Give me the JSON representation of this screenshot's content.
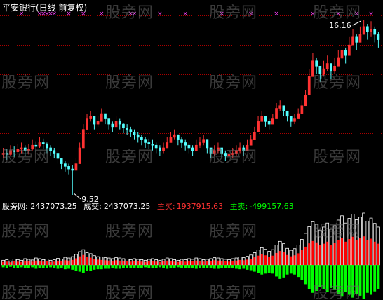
{
  "title": "平安银行(日线 前复权)",
  "watermark_text": "股旁网",
  "indicator": {
    "name_label": "股旁网",
    "name_value": ": 2437073.25",
    "volume_label": "成交:",
    "volume_value": "2437073.25",
    "buy_label": "主买:",
    "buy_value": "1937915.63",
    "sell_label": "主卖:",
    "sell_value": "-499157.63"
  },
  "colors": {
    "up": "#ff3232",
    "down": "#54ffff",
    "buy": "#ff0000",
    "sell": "#00ff00",
    "grid": "#aa0000",
    "marker": "#ff44ff",
    "annotation": "#ffffff"
  },
  "chart_data": [
    {
      "type": "candlestick",
      "annotations": [
        {
          "text": "16.16",
          "value": 16.16,
          "kind": "max"
        },
        {
          "text": "9.52",
          "value": 9.52,
          "kind": "min"
        }
      ],
      "marker_glyph": "×",
      "close": [
        11.1,
        11.05,
        11.2,
        11.15,
        11.25,
        11.3,
        11.2,
        11.25,
        11.4,
        11.35,
        11.5,
        11.45,
        11.3,
        11.2,
        11.1,
        10.9,
        10.7,
        10.6,
        10.5,
        10.45,
        10.7,
        11.3,
        12.0,
        12.4,
        12.5,
        12.2,
        12.3,
        12.6,
        12.4,
        12.2,
        12.1,
        12.3,
        12.2,
        12.05,
        12.0,
        11.9,
        11.8,
        11.7,
        11.6,
        11.5,
        11.45,
        11.4,
        11.3,
        11.2,
        11.3,
        11.5,
        11.7,
        11.8,
        11.6,
        11.5,
        11.4,
        11.3,
        11.2,
        11.4,
        11.5,
        11.6,
        11.3,
        11.1,
        11.2,
        11.3,
        11.1,
        11.0,
        11.05,
        11.1,
        11.2,
        11.3,
        11.2,
        11.4,
        11.6,
        11.9,
        12.3,
        12.5,
        12.3,
        12.2,
        12.4,
        12.8,
        12.9,
        12.7,
        12.5,
        12.3,
        12.4,
        12.6,
        12.9,
        13.3,
        14.0,
        14.6,
        14.4,
        14.1,
        14.3,
        14.5,
        14.2,
        14.4,
        14.7,
        15.0,
        14.8,
        15.2,
        15.5,
        15.3,
        15.6,
        15.9,
        15.7,
        15.8,
        15.6,
        15.4
      ],
      "high": [
        11.3,
        11.25,
        11.4,
        11.35,
        11.45,
        11.5,
        11.4,
        11.45,
        11.6,
        11.55,
        11.7,
        11.65,
        11.5,
        11.4,
        11.3,
        11.1,
        10.9,
        10.8,
        10.7,
        10.65,
        10.9,
        11.5,
        12.2,
        12.6,
        12.7,
        12.4,
        12.5,
        12.8,
        12.6,
        12.4,
        12.3,
        12.5,
        12.4,
        12.25,
        12.2,
        12.1,
        12.0,
        11.9,
        11.8,
        11.7,
        11.65,
        11.6,
        11.5,
        11.4,
        11.5,
        11.7,
        11.9,
        12.0,
        11.8,
        11.7,
        11.6,
        11.5,
        11.4,
        11.6,
        11.7,
        11.8,
        11.5,
        11.3,
        11.4,
        11.5,
        11.3,
        11.2,
        11.25,
        11.3,
        11.4,
        11.5,
        11.4,
        11.6,
        11.8,
        12.1,
        12.5,
        12.7,
        12.5,
        12.4,
        12.6,
        13.0,
        13.1,
        12.9,
        12.7,
        12.5,
        12.6,
        12.8,
        13.1,
        13.5,
        14.3,
        14.9,
        14.7,
        14.4,
        14.6,
        14.8,
        14.5,
        14.7,
        15.0,
        15.3,
        15.1,
        15.5,
        15.8,
        15.6,
        15.9,
        16.16,
        16.0,
        16.1,
        15.9,
        15.7
      ],
      "low": [
        10.9,
        10.85,
        11.0,
        10.95,
        11.05,
        11.1,
        11.0,
        11.05,
        11.2,
        11.15,
        11.3,
        11.25,
        11.1,
        11.0,
        10.9,
        10.7,
        10.5,
        10.4,
        10.3,
        9.52,
        10.5,
        11.1,
        11.8,
        12.2,
        12.3,
        12.0,
        12.1,
        12.4,
        12.2,
        12.0,
        11.9,
        12.1,
        12.0,
        11.85,
        11.8,
        11.7,
        11.6,
        11.5,
        11.4,
        11.3,
        11.25,
        11.2,
        11.1,
        11.0,
        11.1,
        11.3,
        11.5,
        11.6,
        11.4,
        11.3,
        11.2,
        11.1,
        11.0,
        11.2,
        11.3,
        11.4,
        11.1,
        10.9,
        11.0,
        11.1,
        10.9,
        10.8,
        10.85,
        10.9,
        11.0,
        11.1,
        11.0,
        11.2,
        11.4,
        11.7,
        12.1,
        12.3,
        12.1,
        12.0,
        12.2,
        12.6,
        12.7,
        12.5,
        12.3,
        12.1,
        12.2,
        12.4,
        12.7,
        13.1,
        13.7,
        14.3,
        14.1,
        13.8,
        14.0,
        14.2,
        13.9,
        14.1,
        14.4,
        14.7,
        14.5,
        14.9,
        15.2,
        15.0,
        15.3,
        15.6,
        15.4,
        15.5,
        15.3,
        15.1
      ],
      "markers_at_index": [
        5,
        10,
        11,
        12,
        13,
        14,
        18,
        22,
        27,
        35,
        36,
        43,
        50,
        60,
        68,
        75,
        85,
        92,
        97,
        101
      ]
    },
    {
      "type": "bar",
      "series": [
        {
          "name": "主买",
          "role": "buy",
          "values": [
            0.9,
            1.0,
            0.8,
            1.1,
            1.0,
            0.9,
            1.2,
            1.1,
            1.0,
            1.3,
            1.2,
            1.0,
            1.1,
            0.9,
            1.0,
            1.2,
            1.1,
            1.4,
            1.3,
            1.5,
            2.0,
            2.6,
            3.0,
            2.4,
            2.2,
            1.8,
            1.6,
            1.5,
            1.4,
            1.3,
            1.2,
            1.4,
            1.3,
            1.2,
            1.1,
            1.0,
            1.2,
            1.1,
            1.0,
            0.9,
            1.1,
            1.2,
            1.0,
            0.9,
            1.1,
            1.3,
            1.2,
            1.0,
            0.9,
            1.1,
            1.0,
            1.2,
            1.1,
            1.3,
            1.2,
            1.0,
            1.1,
            1.2,
            1.4,
            1.3,
            1.2,
            1.1,
            1.0,
            1.2,
            1.3,
            1.5,
            1.4,
            1.6,
            1.9,
            2.3,
            2.8,
            3.2,
            2.9,
            2.5,
            2.8,
            3.6,
            4.2,
            3.8,
            3.0,
            2.6,
            2.9,
            3.5,
            4.5,
            5.5,
            6.5,
            7.2,
            6.8,
            5.9,
            6.4,
            7.0,
            6.0,
            6.6,
            7.5,
            8.2,
            7.0,
            7.8,
            8.5,
            7.6,
            8.0,
            8.6,
            7.4,
            7.9,
            7.0,
            6.4
          ]
        },
        {
          "name": "主卖",
          "role": "sell",
          "values": [
            -0.5,
            -0.6,
            -0.4,
            -0.7,
            -0.6,
            -0.5,
            -0.7,
            -0.6,
            -0.5,
            -0.8,
            -0.7,
            -0.6,
            -0.7,
            -0.5,
            -0.6,
            -0.8,
            -0.7,
            -0.9,
            -0.8,
            -1.0,
            -1.2,
            -1.4,
            -1.6,
            -1.3,
            -1.2,
            -1.0,
            -0.9,
            -0.9,
            -0.8,
            -0.8,
            -0.7,
            -0.8,
            -0.8,
            -0.7,
            -0.7,
            -0.6,
            -0.7,
            -0.6,
            -0.6,
            -0.5,
            -0.6,
            -0.7,
            -0.6,
            -0.5,
            -0.6,
            -0.8,
            -0.7,
            -0.6,
            -0.5,
            -0.6,
            -0.6,
            -0.7,
            -0.6,
            -0.8,
            -0.7,
            -0.6,
            -0.6,
            -0.7,
            -0.8,
            -0.8,
            -0.7,
            -0.6,
            -0.6,
            -0.7,
            -0.8,
            -0.9,
            -0.8,
            -1.0,
            -1.1,
            -1.4,
            -1.7,
            -2.0,
            -1.8,
            -1.6,
            -1.8,
            -2.4,
            -2.9,
            -2.6,
            -2.0,
            -1.8,
            -2.0,
            -2.5,
            -3.2,
            -4.0,
            -5.0,
            -5.8,
            -5.4,
            -4.6,
            -5.0,
            -5.6,
            -4.8,
            -5.2,
            -6.0,
            -6.6,
            -5.6,
            -6.2,
            -6.8,
            -6.0,
            -6.4,
            -7.0,
            -5.8,
            -6.2,
            -5.5,
            -5.0
          ]
        },
        {
          "name": "成交",
          "role": "total",
          "values": [
            1.4,
            1.6,
            1.2,
            1.8,
            1.6,
            1.4,
            1.9,
            1.7,
            1.5,
            2.1,
            1.9,
            1.6,
            1.8,
            1.4,
            1.6,
            2.0,
            1.8,
            2.3,
            2.1,
            2.5,
            3.2,
            4.0,
            4.6,
            3.7,
            3.4,
            2.8,
            2.5,
            2.4,
            2.2,
            2.1,
            1.9,
            2.2,
            2.1,
            1.9,
            1.8,
            1.6,
            1.9,
            1.7,
            1.6,
            1.4,
            1.7,
            1.9,
            1.6,
            1.4,
            1.7,
            2.1,
            1.9,
            1.6,
            1.4,
            1.7,
            1.6,
            1.9,
            1.7,
            2.1,
            1.9,
            1.6,
            1.7,
            1.9,
            2.2,
            2.1,
            1.9,
            1.7,
            1.6,
            1.9,
            2.1,
            2.4,
            2.2,
            2.6,
            3.0,
            3.7,
            4.5,
            5.2,
            4.7,
            4.1,
            4.6,
            6.0,
            7.1,
            6.4,
            5.0,
            4.4,
            4.9,
            6.0,
            7.7,
            9.5,
            11.5,
            13.0,
            12.2,
            10.5,
            11.4,
            12.6,
            10.8,
            11.8,
            13.5,
            14.8,
            12.6,
            14.0,
            15.3,
            13.6,
            14.4,
            15.6,
            13.2,
            14.1,
            12.5,
            11.4
          ]
        }
      ]
    }
  ]
}
